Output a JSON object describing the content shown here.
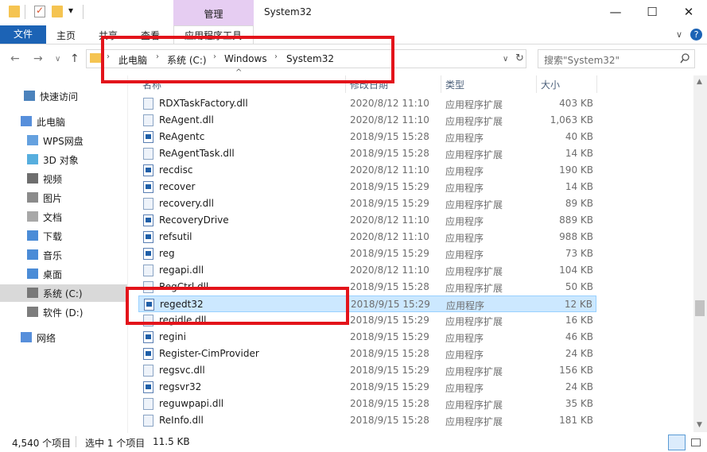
{
  "window": {
    "manage_tab": "管理",
    "title": "System32",
    "minimize": "—",
    "maximize": "☐",
    "close": "✕"
  },
  "ribbon": {
    "file": "文件",
    "home": "主页",
    "share": "共享",
    "view": "查看",
    "app_tools": "应用程序工具",
    "collapse": "∨",
    "help": "?"
  },
  "nav_buttons": {
    "back": "←",
    "forward": "→",
    "recent": "∨",
    "up": "↑"
  },
  "address": {
    "crumbs": [
      "此电脑",
      "系统 (C:)",
      "Windows",
      "System32"
    ],
    "separator": "›",
    "dropdown": "∨",
    "refresh": "↻"
  },
  "search": {
    "placeholder": "搜索\"System32\"",
    "icon": "search-icon"
  },
  "sidebar": [
    {
      "label": "快速访问",
      "icon": "star-icon"
    },
    {
      "label": "此电脑",
      "icon": "computer-icon"
    },
    {
      "label": "WPS网盘",
      "icon": "cloud-icon"
    },
    {
      "label": "3D 对象",
      "icon": "cube-icon"
    },
    {
      "label": "视频",
      "icon": "video-icon"
    },
    {
      "label": "图片",
      "icon": "picture-icon"
    },
    {
      "label": "文档",
      "icon": "document-icon"
    },
    {
      "label": "下载",
      "icon": "download-icon"
    },
    {
      "label": "音乐",
      "icon": "music-icon"
    },
    {
      "label": "桌面",
      "icon": "desktop-icon"
    },
    {
      "label": "系统 (C:)",
      "icon": "drive-icon"
    },
    {
      "label": "软件 (D:)",
      "icon": "drive-icon"
    },
    {
      "label": "网络",
      "icon": "network-icon"
    }
  ],
  "columns": {
    "name": "名称",
    "date": "修改日期",
    "type": "类型",
    "size": "大小"
  },
  "files": [
    {
      "name": "RDXTaskFactory.dll",
      "date": "2020/8/12 11:10",
      "type": "应用程序扩展",
      "size": "403 KB",
      "kind": "dll"
    },
    {
      "name": "ReAgent.dll",
      "date": "2020/8/12 11:10",
      "type": "应用程序扩展",
      "size": "1,063 KB",
      "kind": "dll"
    },
    {
      "name": "ReAgentc",
      "date": "2018/9/15 15:28",
      "type": "应用程序",
      "size": "40 KB",
      "kind": "exe"
    },
    {
      "name": "ReAgentTask.dll",
      "date": "2018/9/15 15:28",
      "type": "应用程序扩展",
      "size": "14 KB",
      "kind": "dll"
    },
    {
      "name": "recdisc",
      "date": "2020/8/12 11:10",
      "type": "应用程序",
      "size": "190 KB",
      "kind": "exe"
    },
    {
      "name": "recover",
      "date": "2018/9/15 15:29",
      "type": "应用程序",
      "size": "14 KB",
      "kind": "exe"
    },
    {
      "name": "recovery.dll",
      "date": "2018/9/15 15:29",
      "type": "应用程序扩展",
      "size": "89 KB",
      "kind": "dll"
    },
    {
      "name": "RecoveryDrive",
      "date": "2020/8/12 11:10",
      "type": "应用程序",
      "size": "889 KB",
      "kind": "exe"
    },
    {
      "name": "refsutil",
      "date": "2020/8/12 11:10",
      "type": "应用程序",
      "size": "988 KB",
      "kind": "exe"
    },
    {
      "name": "reg",
      "date": "2018/9/15 15:29",
      "type": "应用程序",
      "size": "73 KB",
      "kind": "exe"
    },
    {
      "name": "regapi.dll",
      "date": "2020/8/12 11:10",
      "type": "应用程序扩展",
      "size": "104 KB",
      "kind": "dll"
    },
    {
      "name": "RegCtrl.dll",
      "date": "2018/9/15 15:28",
      "type": "应用程序扩展",
      "size": "50 KB",
      "kind": "dll"
    },
    {
      "name": "regedt32",
      "date": "2018/9/15 15:29",
      "type": "应用程序",
      "size": "12 KB",
      "kind": "exe",
      "selected": true
    },
    {
      "name": "regidle.dll",
      "date": "2018/9/15 15:29",
      "type": "应用程序扩展",
      "size": "16 KB",
      "kind": "dll"
    },
    {
      "name": "regini",
      "date": "2018/9/15 15:29",
      "type": "应用程序",
      "size": "46 KB",
      "kind": "exe"
    },
    {
      "name": "Register-CimProvider",
      "date": "2018/9/15 15:28",
      "type": "应用程序",
      "size": "24 KB",
      "kind": "exe"
    },
    {
      "name": "regsvc.dll",
      "date": "2018/9/15 15:29",
      "type": "应用程序扩展",
      "size": "156 KB",
      "kind": "dll"
    },
    {
      "name": "regsvr32",
      "date": "2018/9/15 15:29",
      "type": "应用程序",
      "size": "24 KB",
      "kind": "exe"
    },
    {
      "name": "reguwpapi.dll",
      "date": "2018/9/15 15:28",
      "type": "应用程序扩展",
      "size": "35 KB",
      "kind": "dll"
    },
    {
      "name": "ReInfo.dll",
      "date": "2018/9/15 15:28",
      "type": "应用程序扩展",
      "size": "181 KB",
      "kind": "dll"
    }
  ],
  "status": {
    "count": "4,540 个项目",
    "selection": "选中 1 个项目",
    "size": "11.5 KB"
  },
  "colors": {
    "accent": "#1c63b5",
    "manage_tab": "#e6cdf2",
    "selection": "#cce8ff",
    "highlight_box": "#e3141b"
  }
}
